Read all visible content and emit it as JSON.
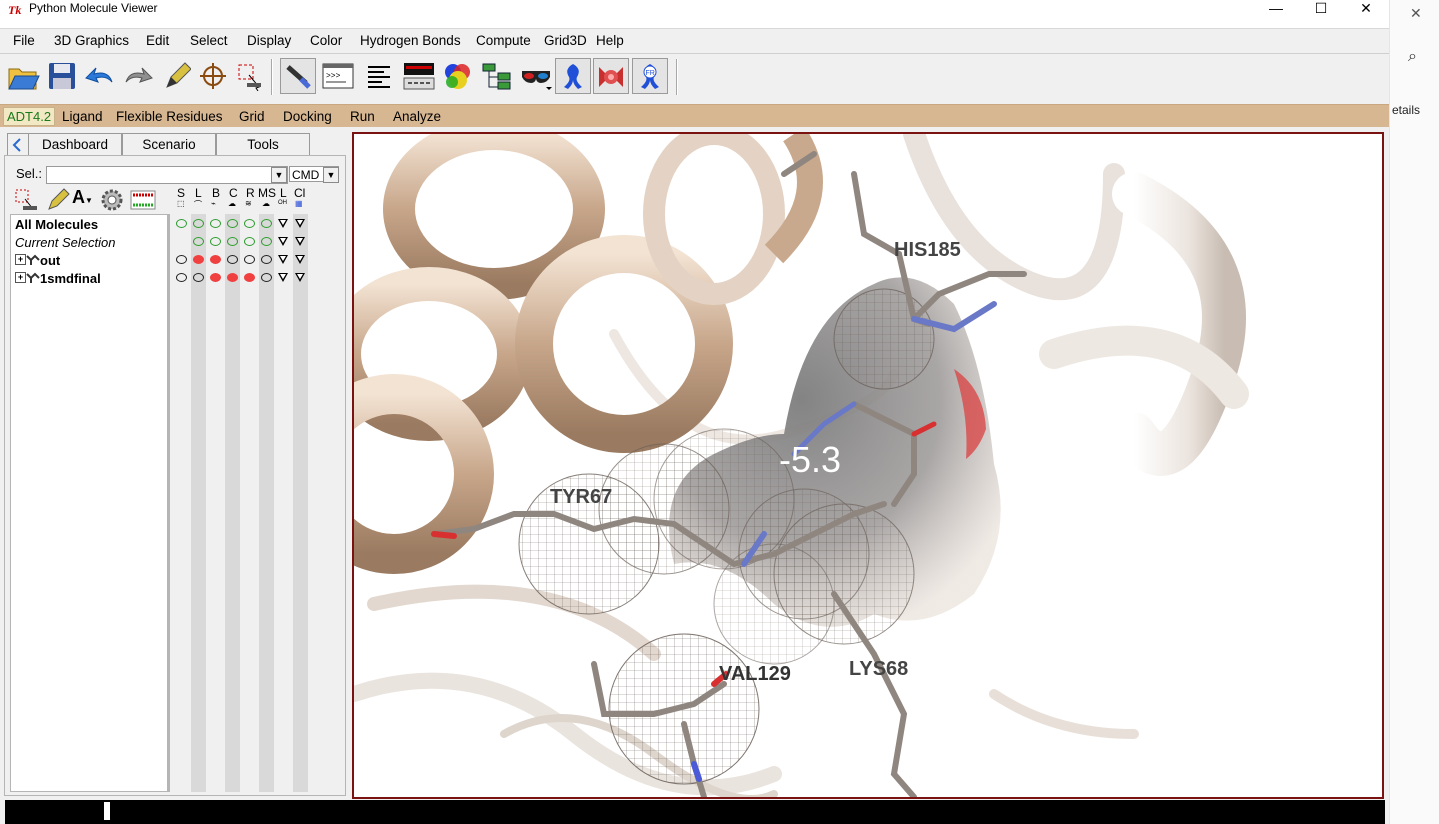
{
  "window": {
    "title": "Python Molecule Viewer",
    "app_icon": "Tk"
  },
  "window_buttons": {
    "minimize": "—",
    "maximize": "☐",
    "close": "✕"
  },
  "menubar": [
    "File",
    "3D Graphics",
    "Edit",
    "Select",
    "Display",
    "Color",
    "Hydrogen Bonds",
    "Compute",
    "Grid3D",
    "Help"
  ],
  "toolbar_icons": [
    "open-folder-icon",
    "save-disk-icon",
    "undo-arrow-icon",
    "redo-arrow-icon",
    "pencil-label-icon",
    "crosshair-pick-icon",
    "select-cursor-icon",
    "wand-icon",
    "python-shell-icon",
    "text-align-icon",
    "dashboard-icon",
    "rgb-spheres-icon",
    "tree-network-icon",
    "stereo-glasses-icon",
    "ribbon-icon",
    "red-surface-icon",
    "fr-icon"
  ],
  "adt_bar": {
    "version": "ADT4.2",
    "items": [
      "Ligand",
      "Flexible Residues",
      "Grid",
      "Docking",
      "Run",
      "Analyze"
    ]
  },
  "left_panel": {
    "tabs": [
      "Dashboard",
      "Scenario",
      "Tools"
    ],
    "sel_label": "Sel.:",
    "sel_value": "",
    "cmd_value": "CMD",
    "column_headers": [
      "S",
      "L",
      "B",
      "C",
      "R",
      "MS",
      "L",
      "Cl"
    ],
    "column_subicons": [
      "⬚",
      "⌒",
      "⌁",
      "☁",
      "≋",
      "☁",
      "OH",
      "▦"
    ],
    "rows": [
      {
        "label": "All Molecules",
        "style": "bold"
      },
      {
        "label": "Current Selection",
        "style": "italic"
      },
      {
        "label": "out",
        "style": "bold",
        "expand": "+"
      },
      {
        "label": "1smdfinal",
        "style": "bold",
        "expand": "+"
      }
    ]
  },
  "viewer": {
    "energy_label": "-5.3",
    "residue_labels": [
      "HIS185",
      "TYR67",
      "VAL129",
      "LYS68"
    ]
  },
  "right_pane": {
    "close": "✕",
    "search": "⌕",
    "text": "etails"
  }
}
